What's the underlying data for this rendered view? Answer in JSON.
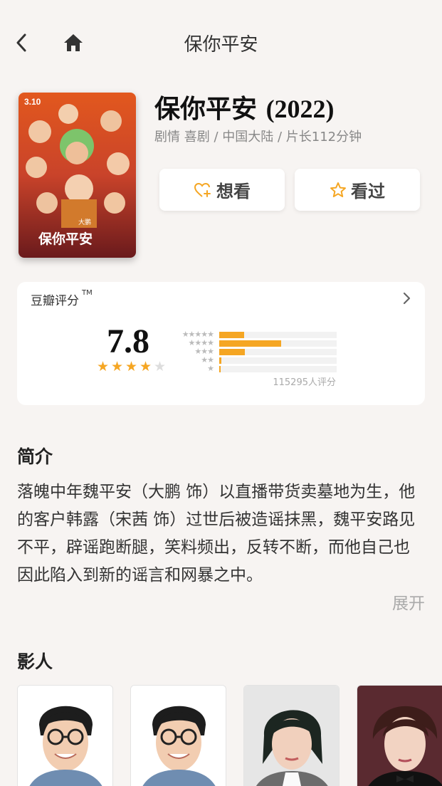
{
  "header": {
    "title": "保你平安"
  },
  "movie": {
    "title": "保你平安",
    "year": "(2022)",
    "meta": "剧情 喜剧 / 中国大陆 / 片长112分钟",
    "poster": {
      "date": "3.10",
      "title": "保你平安",
      "sub": "大鹏"
    }
  },
  "actions": {
    "want_label": "想看",
    "seen_label": "看过"
  },
  "rating": {
    "label": "豆瓣评分",
    "tm": "TM",
    "score": "7.8",
    "score_stars": 4,
    "distribution": [
      {
        "stars": "★★★★★",
        "fraction": 0.21
      },
      {
        "stars": "★★★★",
        "fraction": 0.53
      },
      {
        "stars": "★★★",
        "fraction": 0.22
      },
      {
        "stars": "★★",
        "fraction": 0.02
      },
      {
        "stars": "★",
        "fraction": 0.01
      }
    ],
    "count": "115295人评分",
    "accent_color": "#f5a623"
  },
  "intro": {
    "heading": "简介",
    "text": "落魄中年魏平安（大鹏 饰）以直播带货卖墓地为生，他的客户韩露（宋茜 饰）过世后被造谣抹黑，魏平安路见不平，辟谣跑断腿，笑料频出，反转不断，而他自己也因此陷入到新的谣言和网暴之中。",
    "expand_label": "展开"
  },
  "cast": {
    "heading": "影人",
    "people": [
      {
        "icon": "actor-photo"
      },
      {
        "icon": "actor-photo"
      },
      {
        "icon": "actor-photo"
      },
      {
        "icon": "actor-photo"
      }
    ]
  }
}
